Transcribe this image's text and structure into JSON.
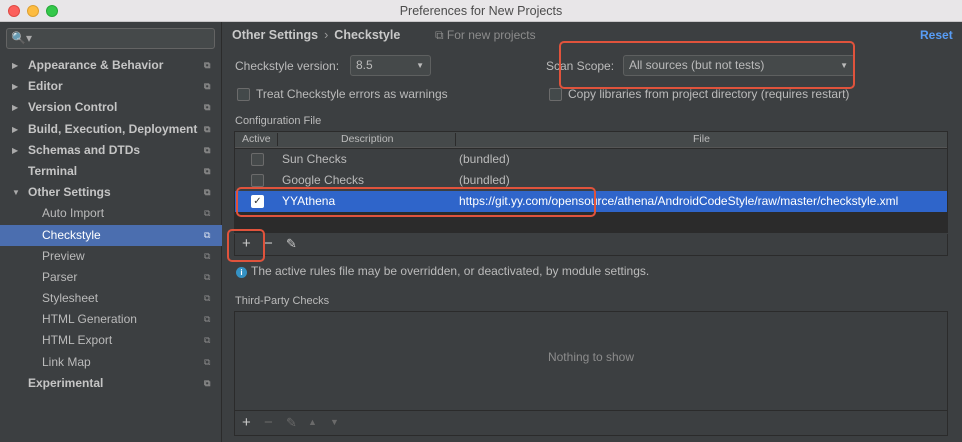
{
  "window": {
    "title": "Preferences for New Projects"
  },
  "sidebar": {
    "search_icon": "🔍▾",
    "items": [
      {
        "label": "Appearance & Behavior",
        "bold": true,
        "arrow": "▶",
        "child": false
      },
      {
        "label": "Editor",
        "bold": true,
        "arrow": "▶",
        "child": false
      },
      {
        "label": "Version Control",
        "bold": true,
        "arrow": "▶",
        "child": false
      },
      {
        "label": "Build, Execution, Deployment",
        "bold": true,
        "arrow": "▶",
        "child": false
      },
      {
        "label": "Schemas and DTDs",
        "bold": true,
        "arrow": "▶",
        "child": false
      },
      {
        "label": "Terminal",
        "bold": true,
        "arrow": "",
        "child": false
      },
      {
        "label": "Other Settings",
        "bold": true,
        "arrow": "▼",
        "child": false
      },
      {
        "label": "Auto Import",
        "bold": false,
        "arrow": "",
        "child": true
      },
      {
        "label": "Checkstyle",
        "bold": false,
        "arrow": "",
        "child": true,
        "selected": true
      },
      {
        "label": "Preview",
        "bold": false,
        "arrow": "",
        "child": true
      },
      {
        "label": "Parser",
        "bold": false,
        "arrow": "",
        "child": true
      },
      {
        "label": "Stylesheet",
        "bold": false,
        "arrow": "",
        "child": true
      },
      {
        "label": "HTML Generation",
        "bold": false,
        "arrow": "",
        "child": true
      },
      {
        "label": "HTML Export",
        "bold": false,
        "arrow": "",
        "child": true
      },
      {
        "label": "Link Map",
        "bold": false,
        "arrow": "",
        "child": true
      },
      {
        "label": "Experimental",
        "bold": true,
        "arrow": "",
        "child": false
      }
    ],
    "config_icon": "⧉"
  },
  "header": {
    "crumb_parent": "Other Settings",
    "crumb_sep": "›",
    "crumb_current": "Checkstyle",
    "for_new": "⧉ For new projects",
    "reset": "Reset"
  },
  "settings": {
    "version_label": "Checkstyle version:",
    "version_value": "8.5",
    "scan_label": "Scan Scope:",
    "scan_value": "All sources (but not tests)",
    "treat_warnings": "Treat Checkstyle errors as warnings",
    "copy_libs": "Copy libraries from project directory (requires restart)",
    "dropdown_icon": "▼"
  },
  "config": {
    "title": "Configuration File",
    "headers": {
      "active": "Active",
      "description": "Description",
      "file": "File"
    },
    "rows": [
      {
        "description": "Sun Checks",
        "file": "(bundled)",
        "checked": ""
      },
      {
        "description": "Google Checks",
        "file": "(bundled)",
        "checked": ""
      },
      {
        "description": "YYAthena",
        "file": "https://git.yy.com/opensource/athena/AndroidCodeStyle/raw/master/checkstyle.xml",
        "checked": "✓"
      }
    ],
    "toolbar": {
      "add": "+",
      "remove": "−",
      "edit": "✎"
    },
    "info_icon": "i",
    "info_text": "The active rules file may be overridden, or deactivated, by module settings."
  },
  "third_party": {
    "title": "Third-Party Checks",
    "empty": "Nothing to show",
    "toolbar": {
      "add": "+",
      "remove": "−",
      "edit": "✎",
      "up": "▲",
      "down": "▼"
    }
  }
}
